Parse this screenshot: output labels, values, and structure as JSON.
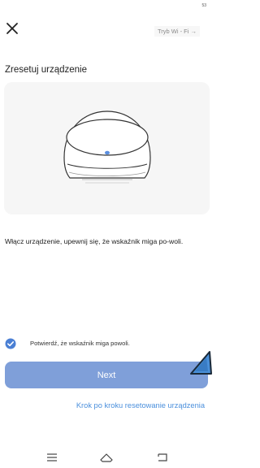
{
  "status_bar": {
    "text": "53"
  },
  "header": {
    "mode_link": "Tryb Wi - Fi →"
  },
  "main": {
    "title": "Zresetuj urządzenie",
    "instruction": "Włącz urządzenie, upewnij się, że wskaźnik miga po-woli.",
    "confirm_label": "Potwierdź, że wskaźnik miga powoli.",
    "confirm_checked": true,
    "next_label": "Next",
    "reset_link": "Krok po kroku resetowanie urządzenia"
  },
  "icons": {
    "close": "close-icon",
    "check": "check-circle-icon",
    "pointer": "cursor-arrow-icon",
    "nav": [
      "menu-icon",
      "home-icon",
      "back-icon"
    ]
  },
  "colors": {
    "accent": "#7f9fd9",
    "link": "#4a8fdc",
    "check": "#4a7fd4",
    "indicator_led": "#5b8fe0",
    "card_bg": "#f6f6f6"
  }
}
